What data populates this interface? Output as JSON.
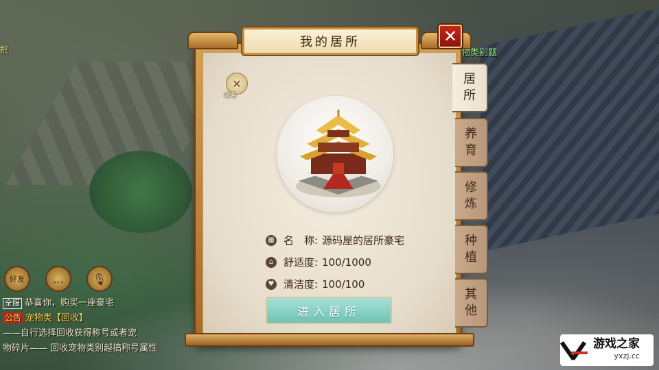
{
  "dialog": {
    "title": "我的居所",
    "close_label": "✕",
    "badge_label": "攻略",
    "tabs": [
      {
        "lines": [
          "居",
          "所"
        ],
        "active": true
      },
      {
        "lines": [
          "养",
          "育"
        ],
        "active": false
      },
      {
        "lines": [
          "修",
          "炼"
        ],
        "active": false
      },
      {
        "lines": [
          "种",
          "植"
        ],
        "active": false
      },
      {
        "lines": [
          "其",
          "他"
        ],
        "active": false
      }
    ],
    "info": [
      {
        "key": "名　称:",
        "value": "源码屋的居所豪宅"
      },
      {
        "key": "舒适度:",
        "value": "100/1000"
      },
      {
        "key": "清洁度:",
        "value": "100/100"
      }
    ],
    "enter_button": "进入居所"
  },
  "hud": {
    "top_left": "根",
    "top_right": "物类别题",
    "icons": [
      {
        "label": "好友"
      },
      {
        "label": "…"
      },
      {
        "label": "🎙"
      }
    ]
  },
  "chat": {
    "line1_tag": "全服",
    "line1_text": "恭喜你，购买一座豪宅",
    "line2_tag": "公告",
    "line2_text": "宠物类【回收】",
    "line3_text": "——自行选择回收获得称号或者宠",
    "line4_text": "物碎片—— 回收宠物类别越搞称号属性"
  },
  "watermark": {
    "brand": "游戏之家",
    "domain": "yxzj.cc"
  },
  "colors": {
    "accent": "#c6261c",
    "button": "#6ec3b6",
    "frame": "#c4913f"
  }
}
